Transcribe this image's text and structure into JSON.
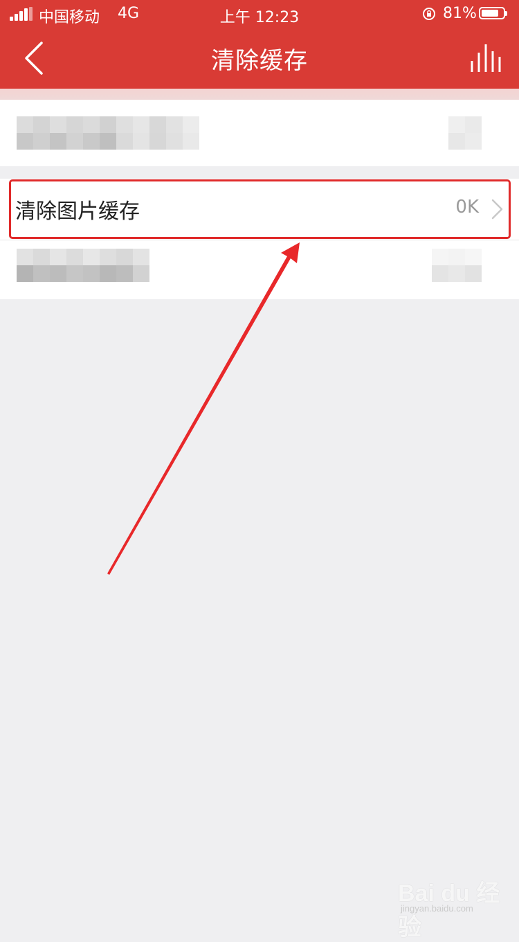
{
  "status_bar": {
    "carrier": "中国移动",
    "network": "4G",
    "time": "上午 12:23",
    "battery": "81%",
    "battery_level": 0.81
  },
  "header": {
    "title": "清除缓存",
    "back_icon": "chevron-left-icon",
    "right_icon": "bar-chart-icon"
  },
  "settings": {
    "image_cache": {
      "label": "清除图片缓存",
      "value": "0K"
    }
  },
  "colors": {
    "header": "#d93b35",
    "highlight": "#e02a2a",
    "background": "#efeff1"
  },
  "watermark": {
    "brand": "Bai du 经验",
    "url": "jingyan.baidu.com"
  }
}
